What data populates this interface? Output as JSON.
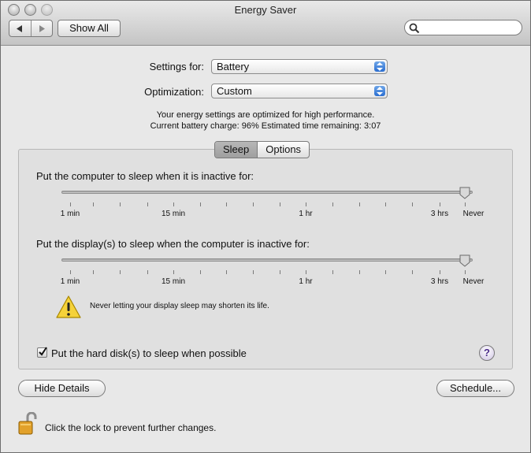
{
  "window": {
    "title": "Energy Saver"
  },
  "toolbar": {
    "back_icon": "back-arrow-icon",
    "forward_icon": "forward-arrow-icon",
    "show_all_label": "Show All",
    "search_placeholder": ""
  },
  "settings_for": {
    "label": "Settings for:",
    "value": "Battery"
  },
  "optimization": {
    "label": "Optimization:",
    "value": "Custom"
  },
  "info": {
    "line1": "Your energy settings are optimized for high performance.",
    "line2": "Current battery charge: 96%  Estimated time remaining: 3:07"
  },
  "tabs": [
    {
      "label": "Sleep",
      "selected": true
    },
    {
      "label": "Options",
      "selected": false
    }
  ],
  "computer_sleep": {
    "label": "Put the computer to sleep when it is inactive for:",
    "value": "Never",
    "ticks": [
      "1 min",
      "15 min",
      "1 hr",
      "3 hrs",
      "Never"
    ]
  },
  "display_sleep": {
    "label": "Put the display(s) to sleep when the computer is inactive for:",
    "value": "Never",
    "ticks": [
      "1 min",
      "15 min",
      "1 hr",
      "3 hrs",
      "Never"
    ]
  },
  "warning": {
    "icon": "warning-icon",
    "text": "Never letting your display sleep may shorten its life."
  },
  "hard_disk": {
    "label": "Put the hard disk(s) to sleep when possible",
    "checked": true
  },
  "buttons": {
    "hide_details": "Hide Details",
    "schedule": "Schedule..."
  },
  "help": {
    "label": "?"
  },
  "lock": {
    "icon": "unlocked-padlock-icon",
    "text": "Click the lock to prevent further changes."
  }
}
